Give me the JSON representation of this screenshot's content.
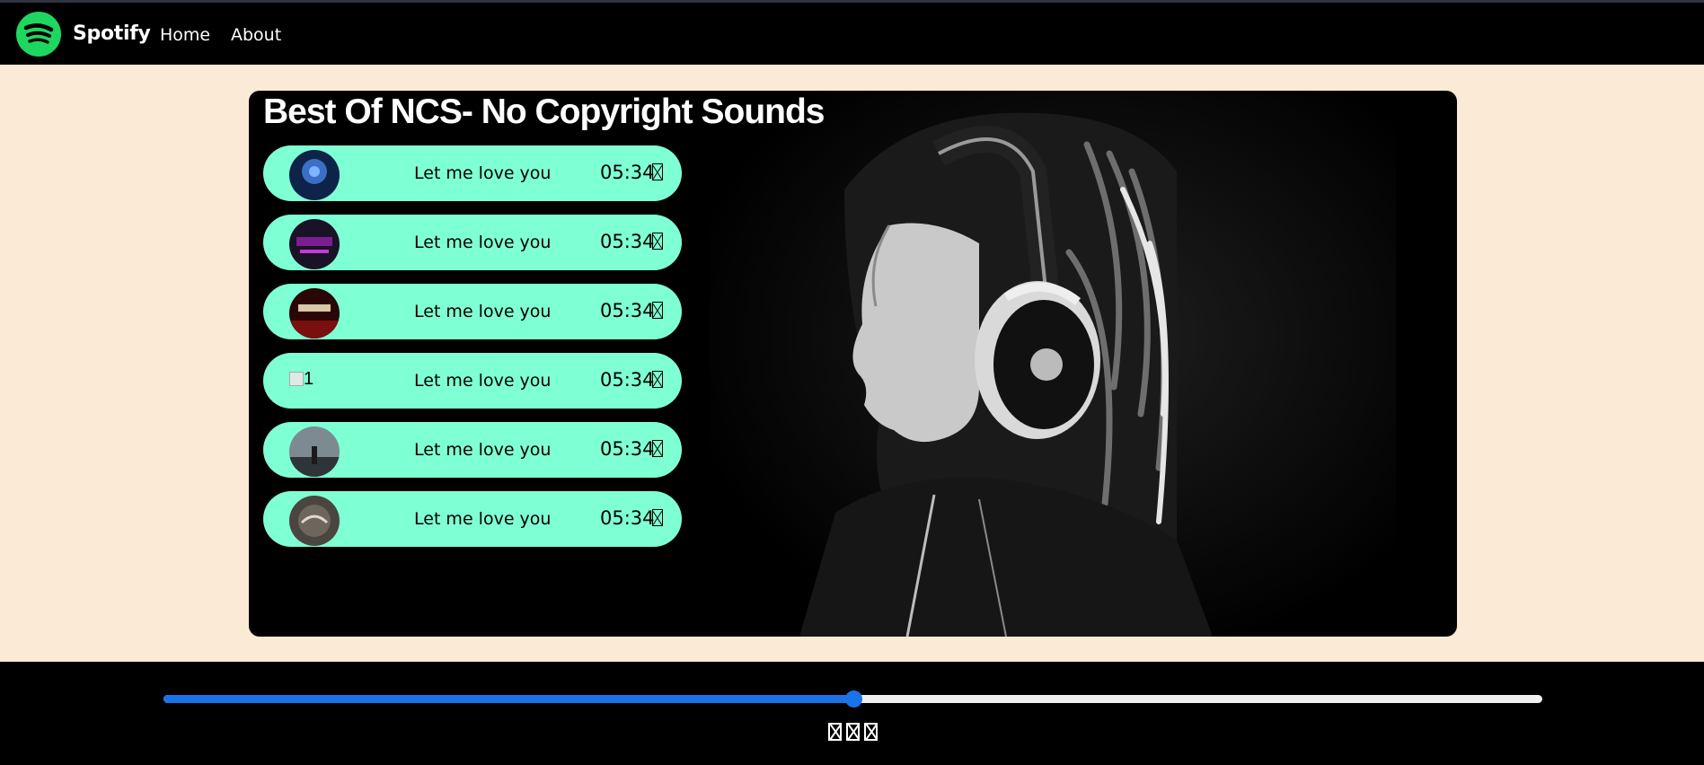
{
  "navbar": {
    "brand": "Spotify",
    "links": [
      {
        "label": "Home"
      },
      {
        "label": "About"
      }
    ]
  },
  "main": {
    "title": "Best Of NCS- No Copyright Sounds",
    "songs": [
      {
        "name": "Let me love you",
        "duration": "05:34",
        "thumb_color": "#1e4a8c",
        "thumb_icon": "album-art-icon"
      },
      {
        "name": "Let me love you",
        "duration": "05:34",
        "thumb_color": "#2b1d3a",
        "thumb_icon": "album-art-icon"
      },
      {
        "name": "Let me love you",
        "duration": "05:34",
        "thumb_color": "#4a0c0c",
        "thumb_icon": "album-art-icon"
      },
      {
        "name": "Let me love you",
        "duration": "05:34",
        "thumb_alt": "1",
        "thumb_icon": "broken-image-icon"
      },
      {
        "name": "Let me love you",
        "duration": "05:34",
        "thumb_color": "#556066",
        "thumb_icon": "album-art-icon"
      },
      {
        "name": "Let me love you",
        "duration": "05:34",
        "thumb_color": "#5c564d",
        "thumb_icon": "album-art-icon"
      }
    ]
  },
  "player": {
    "progress": 0.5,
    "controls": [
      {
        "icon": "previous-icon"
      },
      {
        "icon": "play-icon"
      },
      {
        "icon": "next-icon"
      }
    ]
  },
  "colors": {
    "page_bg": "#faead6",
    "song_item_bg": "#7fffd4",
    "accent": "#1a73e8",
    "brand_green": "#1ed760"
  }
}
